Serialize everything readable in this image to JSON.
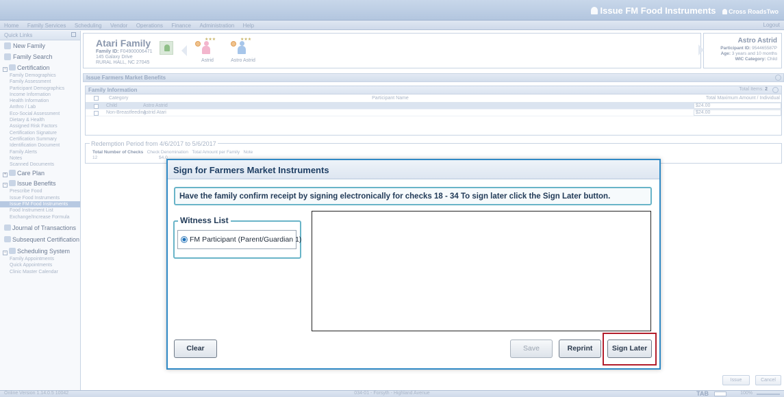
{
  "header": {
    "title": "Issue FM Food Instruments",
    "user": "Cross RoadsTwo",
    "menu": [
      "Home",
      "Family Services",
      "Scheduling",
      "Vendor",
      "Operations",
      "Finance",
      "Administration",
      "Help"
    ],
    "logout": "Logout"
  },
  "sidebar": {
    "quick_links": "Quick Links",
    "new_family": "New Family",
    "family_search": "Family Search",
    "certification": {
      "label": "Certification",
      "items": [
        "Family Demographics",
        "Family Assessment",
        "Participant Demographics",
        "Income Information",
        "Health Information",
        "Anthro / Lab",
        "Eco-Social Assessment",
        "Dietary & Health",
        "Assigned Risk Factors",
        "Certification Signature",
        "Certification Summary",
        "Identification Document",
        "Family Alerts",
        "Notes",
        "Scanned Documents"
      ]
    },
    "care_plan": "Care Plan",
    "issue_benefits": {
      "label": "Issue Benefits",
      "items": [
        "Prescribe Food",
        "Issue Food Instruments",
        "Issue FM Food Instruments",
        "Food Instrument List",
        "Exchange/Increase Formula"
      ]
    },
    "journal": "Journal of Transactions",
    "subsequent": "Subsequent Certification",
    "scheduling": {
      "label": "Scheduling System",
      "items": [
        "Family Appointments",
        "Quick Appointments",
        "Clinic Master Calendar"
      ]
    }
  },
  "family": {
    "name": "Atari Family",
    "id_label": "Family ID:",
    "id_value": "F04900006471",
    "address1": "145 Galaxy Drive",
    "address2": "RURAL HALL,  NC  27045",
    "members": [
      "Astrid",
      "Astro Astrid"
    ],
    "stars": "★★★"
  },
  "participant": {
    "name": "Astro Astrid",
    "id_label": "Participant ID:",
    "id_value": "954465587P",
    "age_label": "Age:",
    "age_value": "3 years and 10 months",
    "wic_label": "WIC Category:",
    "wic_value": "Child"
  },
  "benefits": {
    "panel_title": "Issue Farmers Market Benefits",
    "family_info": "Family Information",
    "total_label": "Total Items:",
    "total_value": "2",
    "col_category": "Category",
    "col_participant": "Participant Name",
    "col_amount": "Total Maximum Amount / Individual",
    "rows": [
      {
        "category": "Child",
        "participant": "Astro Astrid",
        "amount": "$24.00"
      },
      {
        "category": "Non-Breastfeeding",
        "participant": "Astrid Atari",
        "amount": "$24.00"
      }
    ],
    "redemption": "Redemption Period from 4/6/2017 to 5/6/2017",
    "rp_total_checks": "Total Number of Checks",
    "rp_denomination": "Check Denomination",
    "rp_total_amount": "Total Amount per Family",
    "rp_note": "Note",
    "rp_checks_value": "12",
    "rp_denom_value": "$4.0"
  },
  "bottom_buttons": {
    "issue": "Issue",
    "cancel": "Cancel"
  },
  "status": {
    "version": "Online  Version 1.14.0.5  10042",
    "clinic": "034-01 - Forsyth - Highland Avenue",
    "tab": "TAB",
    "zoom": "100%"
  },
  "dialog": {
    "title": "Sign for Farmers Market Instruments",
    "instruction": "Have the family confirm receipt by signing electronically for checks 18 - 34 To sign later click the Sign Later button.",
    "witness_legend": "Witness List",
    "witness_item": "FM Participant  (Parent/Guardian 1)",
    "clear": "Clear",
    "save": "Save",
    "reprint": "Reprint",
    "sign_later": "Sign Later"
  },
  "colors": {
    "dialog_border": "#2f89c5",
    "highlight": "#b21d2b",
    "accent": "#69b4c8"
  }
}
